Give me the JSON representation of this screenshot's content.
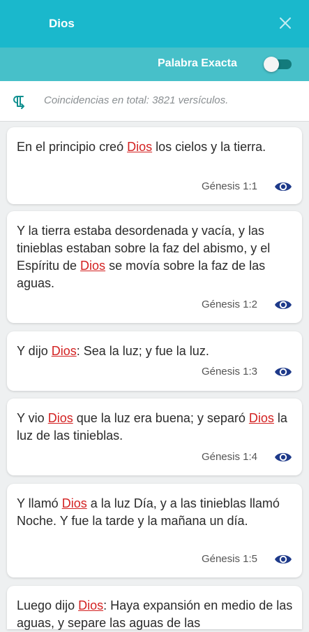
{
  "header": {
    "title": "Dios"
  },
  "filter": {
    "label": "Palabra Exacta",
    "toggle_on": false
  },
  "info": {
    "count_text": "Coincidencias en total: 3821 versículos."
  },
  "colors": {
    "header": "#1ab8cc",
    "subbar": "#47c0c9",
    "highlight": "#d32222",
    "icon": "#1e3a8a"
  },
  "verses": [
    {
      "parts": [
        "En el principio creó ",
        "Dios",
        " los cielos y la tierra."
      ],
      "ref": "Génesis 1:1"
    },
    {
      "parts": [
        "Y la tierra estaba desordenada y vacía, y las tinieblas estaban sobre la faz del abismo, y el Espíritu de ",
        "Dios",
        " se movía sobre la faz de las aguas."
      ],
      "ref": "Génesis 1:2"
    },
    {
      "parts": [
        "Y dijo ",
        "Dios",
        ": Sea la luz; y fue la luz."
      ],
      "ref": "Génesis 1:3"
    },
    {
      "parts": [
        "Y vio ",
        "Dios",
        " que la luz era buena; y separó ",
        "Dios",
        " la luz de las tinieblas."
      ],
      "ref": "Génesis 1:4"
    },
    {
      "parts": [
        "Y llamó ",
        "Dios",
        " a la luz Día, y a las tinieblas llamó Noche. Y fue la tarde y la mañana un día."
      ],
      "ref": "Génesis 1:5"
    },
    {
      "parts": [
        "Luego dijo ",
        "Dios",
        ": Haya expansión en medio de las aguas, y separe las aguas de las"
      ],
      "ref": ""
    }
  ]
}
